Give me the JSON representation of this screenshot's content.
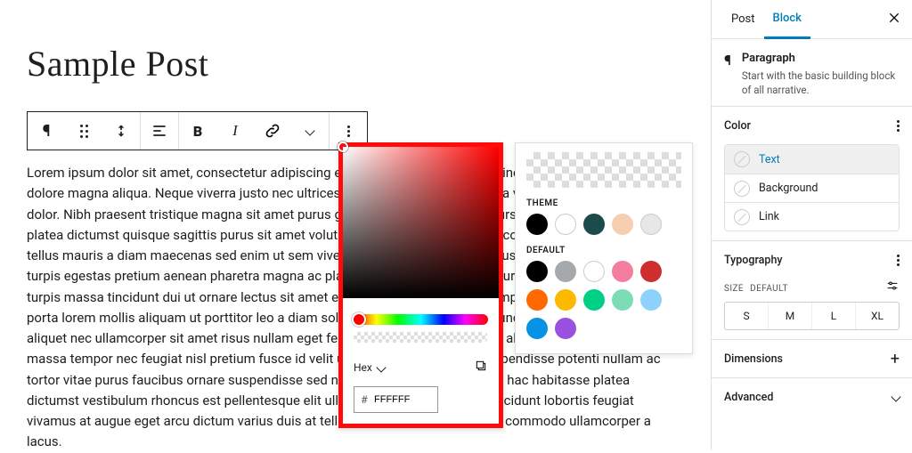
{
  "post": {
    "title": "Sample Post"
  },
  "paragraph": {
    "text": "Lorem ipsum dolor sit amet, consectetur adipiscing elit, sed do eiusmod tempor incididunt ut labore et dolore magna aliqua. Neque viverra justo nec ultrices dui sapien eget mi. Pharetra vel turpis nunc eget lorem dolor. Nibh praesent tristique magna sit amet purus gravida quis blandit turpis cursus in hac habitasse platea dictumst quisque sagittis purus sit amet volutpat consequat mauris nunc congue nisi vitae suscipit tellus mauris a diam maecenas sed enim ut sem viverra aliquet eget sit amet tellus cras adipiscing enim eu turpis egestas pretium aenean pharetra magna ac placerat vestibulum lectus mauris ultrices eros in cursus turpis massa tincidunt dui ut ornare lectus sit amet est placerat in egestas erat imperdiet sed euismod nisi porta lorem mollis aliquam ut porttitor leo a diam sollicitudin tempor id eu nisl nunc mi ipsum faucibus vitae aliquet nec ullamcorper sit amet risus nullam eget felis eget nunc lobortis mattis aliquam faucibus purus in massa tempor nec feugiat nisl pretium fusce id velit ut tortor pretium viverra suspendisse potenti nullam ac tortor vitae purus faucibus ornare suspendisse sed nisi lacus sed viverra tellus in hac habitasse platea dictumst vestibulum rhoncus est pellentesque elit ullamcorper dignissim cras tincidunt lobortis feugiat vivamus at augue eget arcu dictum varius duis at tellus. Metus dictum at tempor commodo ullamcorper a lacus."
  },
  "color_picker": {
    "format_label": "Hex",
    "hex_prefix": "#",
    "hex_value": "FFFFFF"
  },
  "swatch_popover": {
    "theme_label": "THEME",
    "theme_colors": [
      "#000000",
      "#ffffff",
      "#1b4b4a",
      "#f6cfb2",
      "#e7e7e7"
    ],
    "default_label": "DEFAULT",
    "default_colors": [
      "#000000",
      "#a6a9ab",
      "#ffffff",
      "#f57da0",
      "#cf2e2e",
      "#ff6900",
      "#fcb900",
      "#00d084",
      "#7bdcb5",
      "#8ed1fc",
      "#0693e3",
      "#9b51e0"
    ]
  },
  "sidebar": {
    "tabs": {
      "post": "Post",
      "block": "Block"
    },
    "block": {
      "name": "Paragraph",
      "description": "Start with the basic building block of all narrative."
    },
    "panels": {
      "color": {
        "title": "Color",
        "rows": {
          "text": "Text",
          "background": "Background",
          "link": "Link"
        }
      },
      "typography": {
        "title": "Typography",
        "size_label": "SIZE",
        "size_default": "DEFAULT",
        "sizes": [
          "S",
          "M",
          "L",
          "XL"
        ]
      },
      "dimensions": {
        "title": "Dimensions"
      },
      "advanced": {
        "title": "Advanced"
      }
    }
  }
}
